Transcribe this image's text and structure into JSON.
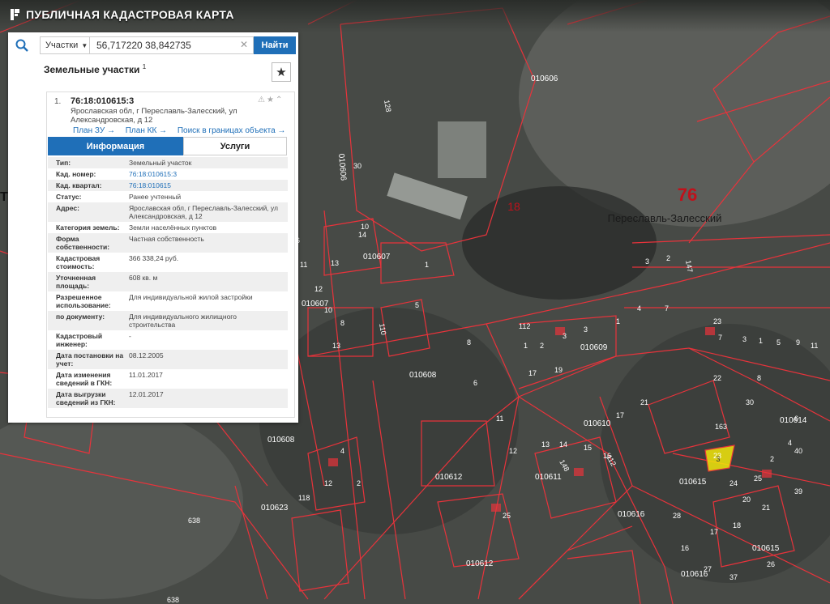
{
  "app": {
    "title": "ПУБЛИЧНАЯ КАДАСТРОВАЯ КАРТА"
  },
  "search": {
    "category": "Участки",
    "value": "56,717220 38,842735",
    "button": "Найти"
  },
  "result_panel": {
    "title": "Земельные участки",
    "count": "1"
  },
  "card": {
    "index": "1.",
    "number": "76:18:010615:3",
    "address": "Ярославская обл, г Переславль-Залесский, ул Александровская, д 12",
    "links": [
      "План ЗУ →",
      "План КК →",
      "Поиск в границах объекта →"
    ],
    "tabs": [
      "Информация",
      "Услуги"
    ],
    "rows": [
      {
        "k": "Тип:",
        "v": "Земельный участок"
      },
      {
        "k": "Кад. номер:",
        "v": "76:18:010615:3"
      },
      {
        "k": "Кад. квартал:",
        "v": "76:18:010615"
      },
      {
        "k": "Статус:",
        "v": "Ранее учтенный"
      },
      {
        "k": "Адрес:",
        "v": "Ярославская обл, г Переславль-Залесский, ул Александровская, д 12"
      },
      {
        "k": "Категория земель:",
        "v": "Земли населённых пунктов"
      },
      {
        "k": "Форма собственности:",
        "v": "Частная собственность"
      },
      {
        "k": "Кадастровая стоимость:",
        "v": "366 338,24 руб."
      },
      {
        "k": "Уточненная площадь:",
        "v": "608 кв. м"
      },
      {
        "k": "Разрешенное использование:",
        "v": "Для индивидуальной жилой застройки"
      },
      {
        "k": "по документу:",
        "v": "Для индивидуального жилищного строительства"
      },
      {
        "k": "Кадастровый инженер:",
        "v": "-"
      },
      {
        "k": "Дата постановки на учет:",
        "v": "08.12.2005"
      },
      {
        "k": "Дата изменения сведений в ГКН:",
        "v": "11.01.2017"
      },
      {
        "k": "Дата выгрузки сведений из ГКН:",
        "v": "12.01.2017"
      }
    ]
  },
  "map": {
    "district_number": "76",
    "city": "Переславль-Залесский",
    "district_label_18": "18",
    "left_label": "Ть-Зал",
    "selected_parcel": "3",
    "quarters": [
      "010606",
      "010606",
      "010607",
      "010607",
      "010608",
      "010608",
      "010609",
      "010610",
      "010611",
      "010612",
      "010612",
      "010614",
      "010615",
      "010615",
      "010616",
      "010616",
      "010623",
      "01062"
    ],
    "numbers": [
      "14",
      "30",
      "10",
      "11",
      "13",
      "16",
      "12",
      "10",
      "8",
      "13",
      "1",
      "5",
      "3",
      "2",
      "17",
      "19",
      "3",
      "1",
      "2",
      "1",
      "3",
      "4",
      "7",
      "6",
      "8",
      "11",
      "12",
      "13",
      "14",
      "15",
      "16",
      "17",
      "21",
      "22",
      "23",
      "24",
      "25",
      "2",
      "4",
      "6",
      "8",
      "7",
      "3",
      "1",
      "5",
      "9",
      "11",
      "16",
      "17",
      "18",
      "20",
      "21",
      "26",
      "27",
      "28",
      "30",
      "37",
      "39",
      "40",
      "12",
      "4",
      "2",
      "25",
      "23"
    ],
    "roads": [
      "112",
      "112",
      "110",
      "118",
      "148",
      "163",
      "147",
      "638",
      "638",
      "128"
    ]
  },
  "colors": {
    "accent": "#1f6fb8",
    "parcel_line": "#e8333b",
    "selected": "#f2e60b"
  }
}
